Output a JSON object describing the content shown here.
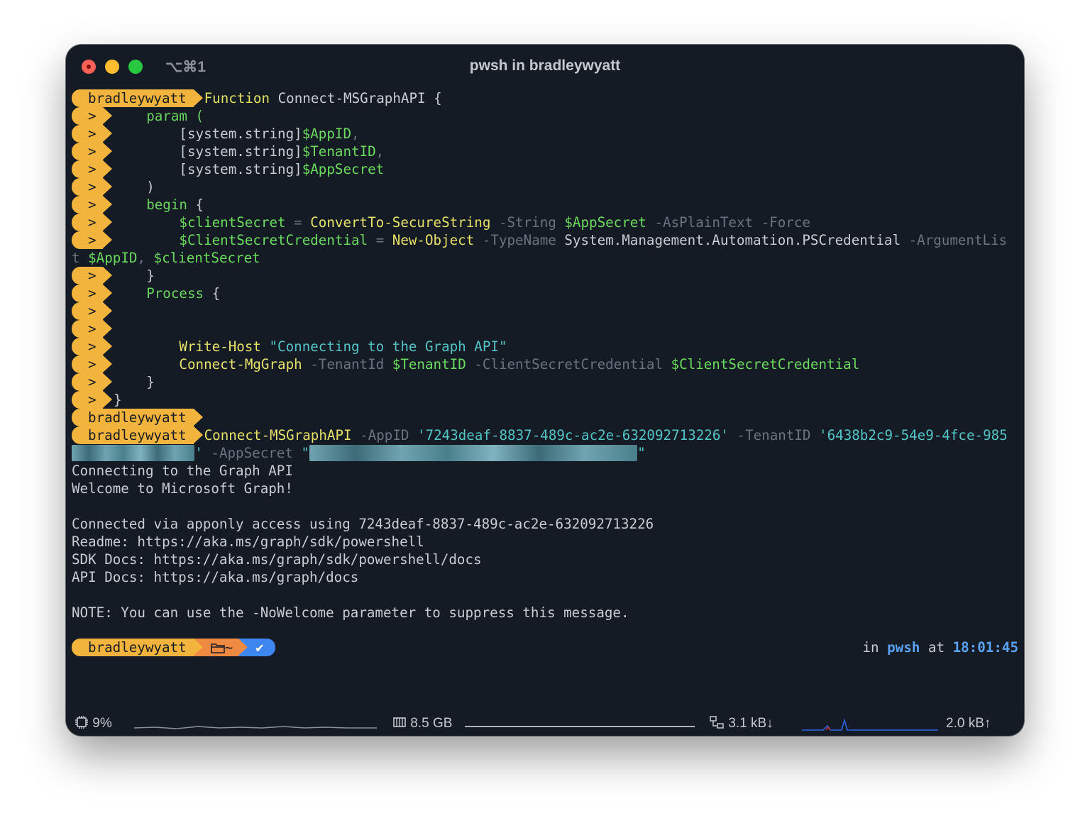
{
  "window": {
    "title": "pwsh in bradleywyatt",
    "shortcut": "⌥⌘1"
  },
  "prompt": {
    "user": "bradleywyatt",
    "cont": ">",
    "path_icon": "folder-icon",
    "path": "~",
    "status": "✔",
    "in": "in",
    "shell": "pwsh",
    "at": "at",
    "time": "18:01:45"
  },
  "code": {
    "l1_fn": "Function",
    "l1_name": "Connect-MSGraphAPI {",
    "l2": "    param (",
    "l3_type": "        [system.string]",
    "l3_var": "$AppID",
    "l3_comma": ",",
    "l4_type": "        [system.string]",
    "l4_var": "$TenantID",
    "l4_comma": ",",
    "l5_type": "        [system.string]",
    "l5_var": "$AppSecret",
    "l6": "    )",
    "l7_kw": "    begin",
    "l7_brace": " {",
    "l8_var": "        $clientSecret",
    "l8_eq": " = ",
    "l8_cmd": "ConvertTo-SecureString",
    "l8_p1": " -String ",
    "l8_v2": "$AppSecret",
    "l8_p2": " -AsPlainText -Force",
    "l9_var": "        $ClientSecretCredential",
    "l9_eq": " = ",
    "l9_cmd": "New-Object",
    "l9_p1": " -TypeName ",
    "l9_type": "System.Management.Automation.PSCredential",
    "l9_p2": " -ArgumentLis",
    "l10_wrap": "t ",
    "l10_v1": "$AppID",
    "l10_comma": ", ",
    "l10_v2": "$clientSecret",
    "l11": "    }",
    "l12_kw": "    Process",
    "l12_brace": " {",
    "l15_cmd": "        Write-Host",
    "l15_str": " \"Connecting to the Graph API\"",
    "l16_cmd": "        Connect-MgGraph",
    "l16_p1": " -TenantId ",
    "l16_v1": "$TenantID",
    "l16_p2": " -ClientSecretCredential ",
    "l16_v2": "$ClientSecretCredential",
    "l17": "    }",
    "l18": "}"
  },
  "command": {
    "cmd": "Connect-MSGraphAPI",
    "p1": " -AppID ",
    "appid": "'7243deaf-8837-489c-ac2e-632092713226'",
    "p2": " -TenantID ",
    "tenant": "'6438b2c9-54e9-4fce-985",
    "tenant_cont_tail": "'",
    "p3": " -AppSecret ",
    "secret_open": "\"",
    "secret_close": "\""
  },
  "output": {
    "o1": "Connecting to the Graph API",
    "o2": "Welcome to Microsoft Graph!",
    "o3": "Connected via apponly access using 7243deaf-8837-489c-ac2e-632092713226",
    "o4": "Readme: https://aka.ms/graph/sdk/powershell",
    "o5": "SDK Docs: https://aka.ms/graph/sdk/powershell/docs",
    "o6": "API Docs: https://aka.ms/graph/docs",
    "o7": "NOTE: You can use the -NoWelcome parameter to suppress this message."
  },
  "statusbar": {
    "cpu_icon": "cpu-icon",
    "cpu": "9%",
    "mem_icon": "memory-icon",
    "mem": "8.5 GB",
    "net_icon": "network-icon",
    "down": "3.1 kB↓",
    "up": "2.0 kB↑"
  },
  "colors": {
    "background": "#151b24",
    "prompt_user": "#f2b43c",
    "prompt_path": "#ef8a42",
    "prompt_status": "#3e86f0"
  }
}
